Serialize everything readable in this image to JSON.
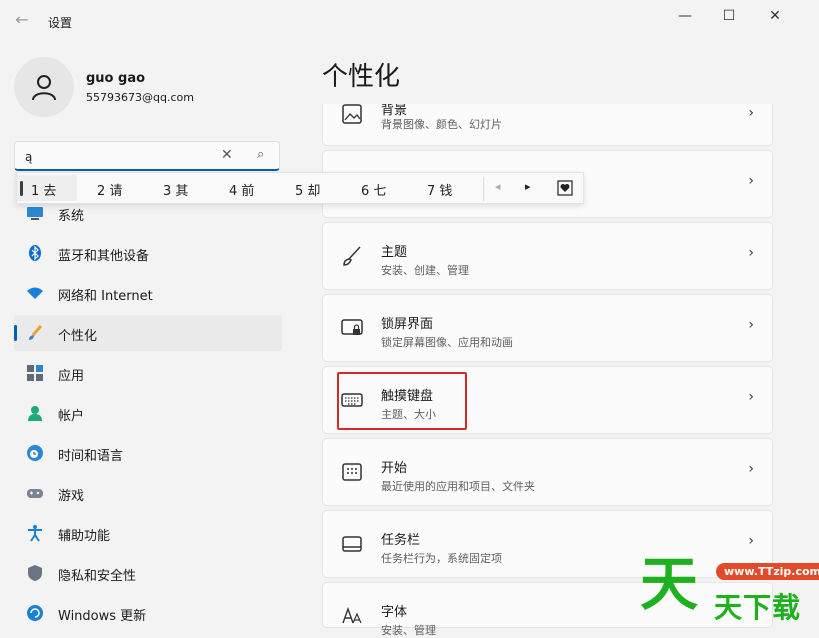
{
  "window": {
    "back_glyph": "←",
    "title": "设置",
    "minimize": "—",
    "maximize": "☐",
    "close": "✕"
  },
  "user": {
    "name": "guo gao",
    "email": "55793673@qq.com"
  },
  "search": {
    "value": "ą",
    "clear_glyph": "✕",
    "search_glyph": "⌕"
  },
  "ime": {
    "candidates": [
      "1 去",
      "2 请",
      "3 其",
      "4 前",
      "5 却",
      "6 七",
      "7 钱"
    ],
    "prev_glyph": "◂",
    "next_glyph": "▸"
  },
  "nav": {
    "items": [
      {
        "label": "系统",
        "icon": "system-icon"
      },
      {
        "label": "蓝牙和其他设备",
        "icon": "bluetooth-icon"
      },
      {
        "label": "网络和 Internet",
        "icon": "wifi-icon"
      },
      {
        "label": "个性化",
        "icon": "brush-icon",
        "active": true
      },
      {
        "label": "应用",
        "icon": "apps-icon"
      },
      {
        "label": "帐户",
        "icon": "account-icon"
      },
      {
        "label": "时间和语言",
        "icon": "clock-globe-icon"
      },
      {
        "label": "游戏",
        "icon": "gamepad-icon"
      },
      {
        "label": "辅助功能",
        "icon": "accessibility-icon"
      },
      {
        "label": "隐私和安全性",
        "icon": "shield-icon"
      },
      {
        "label": "Windows 更新",
        "icon": "update-icon"
      }
    ]
  },
  "main": {
    "title": "个性化",
    "cards": [
      {
        "title": "背景",
        "subtitle": "背景图像、颜色、幻灯片",
        "icon": "image-icon"
      },
      {
        "title": "",
        "subtitle": "",
        "icon": ""
      },
      {
        "title": "主题",
        "subtitle": "安装、创建、管理",
        "icon": "brush-icon"
      },
      {
        "title": "锁屏界面",
        "subtitle": "锁定屏幕图像、应用和动画",
        "icon": "lockscreen-icon"
      },
      {
        "title": "触摸键盘",
        "subtitle": "主题、大小",
        "icon": "keyboard-icon"
      },
      {
        "title": "开始",
        "subtitle": "最近使用的应用和项目、文件夹",
        "icon": "start-icon"
      },
      {
        "title": "任务栏",
        "subtitle": "任务栏行为，系统固定项",
        "icon": "taskbar-icon"
      },
      {
        "title": "字体",
        "subtitle": "安装、管理",
        "icon": "font-icon"
      }
    ],
    "chevron": "›"
  },
  "watermark": {
    "big": "天",
    "url": "www.TTzip.com",
    "small": "天下载"
  },
  "colors": {
    "accent": "#005fb8",
    "highlight": "#d62a2a",
    "watermark_green": "#1fb01f"
  }
}
